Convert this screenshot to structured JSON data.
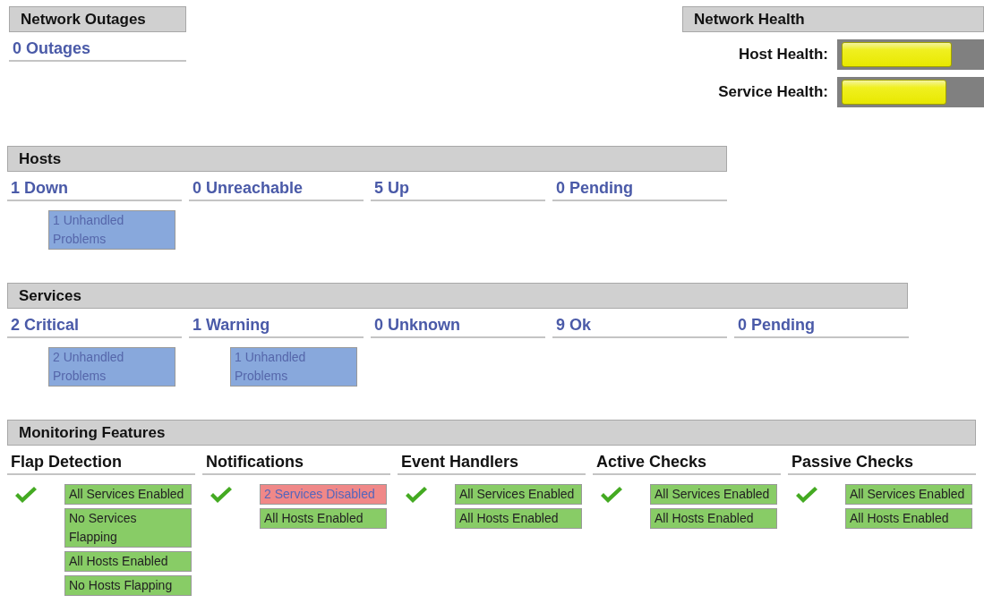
{
  "network_outages": {
    "title": "Network Outages",
    "count": "0 Outages"
  },
  "network_health": {
    "title": "Network Health",
    "meters": [
      {
        "label": "Host Health:",
        "level": 0.8
      },
      {
        "label": "Service Health:",
        "level": 0.76
      }
    ]
  },
  "hosts": {
    "title": "Hosts",
    "columns": [
      {
        "label": "1 Down",
        "boxes": [
          {
            "kind": "problem",
            "text": "1 Unhandled Problems"
          }
        ]
      },
      {
        "label": "0 Unreachable"
      },
      {
        "label": "5 Up"
      },
      {
        "label": "0 Pending"
      }
    ]
  },
  "services": {
    "title": "Services",
    "columns": [
      {
        "label": "2 Critical",
        "boxes": [
          {
            "kind": "problem",
            "text": "2 Unhandled Problems"
          }
        ]
      },
      {
        "label": "1 Warning",
        "boxes": [
          {
            "kind": "problem",
            "text": "1 Unhandled Problems"
          }
        ]
      },
      {
        "label": "0 Unknown"
      },
      {
        "label": "9 Ok"
      },
      {
        "label": "0 Pending"
      }
    ]
  },
  "monitoring_features": {
    "title": "Monitoring Features",
    "features": [
      {
        "label": "Flap Detection",
        "boxes": [
          {
            "kind": "ok",
            "text": "All Services Enabled"
          },
          {
            "kind": "ok",
            "text": "No Services Flapping"
          },
          {
            "kind": "ok",
            "text": "All Hosts Enabled"
          },
          {
            "kind": "ok",
            "text": "No Hosts Flapping"
          }
        ]
      },
      {
        "label": "Notifications",
        "boxes": [
          {
            "kind": "disabled",
            "text": "2 Services Disabled"
          },
          {
            "kind": "ok",
            "text": "All Hosts Enabled"
          }
        ]
      },
      {
        "label": "Event Handlers",
        "boxes": [
          {
            "kind": "ok",
            "text": "All Services Enabled"
          },
          {
            "kind": "ok",
            "text": "All Hosts Enabled"
          }
        ]
      },
      {
        "label": "Active Checks",
        "boxes": [
          {
            "kind": "ok",
            "text": "All Services Enabled"
          },
          {
            "kind": "ok",
            "text": "All Hosts Enabled"
          }
        ]
      },
      {
        "label": "Passive Checks",
        "boxes": [
          {
            "kind": "ok",
            "text": "All Services Enabled"
          },
          {
            "kind": "ok",
            "text": "All Hosts Enabled"
          }
        ]
      }
    ]
  }
}
